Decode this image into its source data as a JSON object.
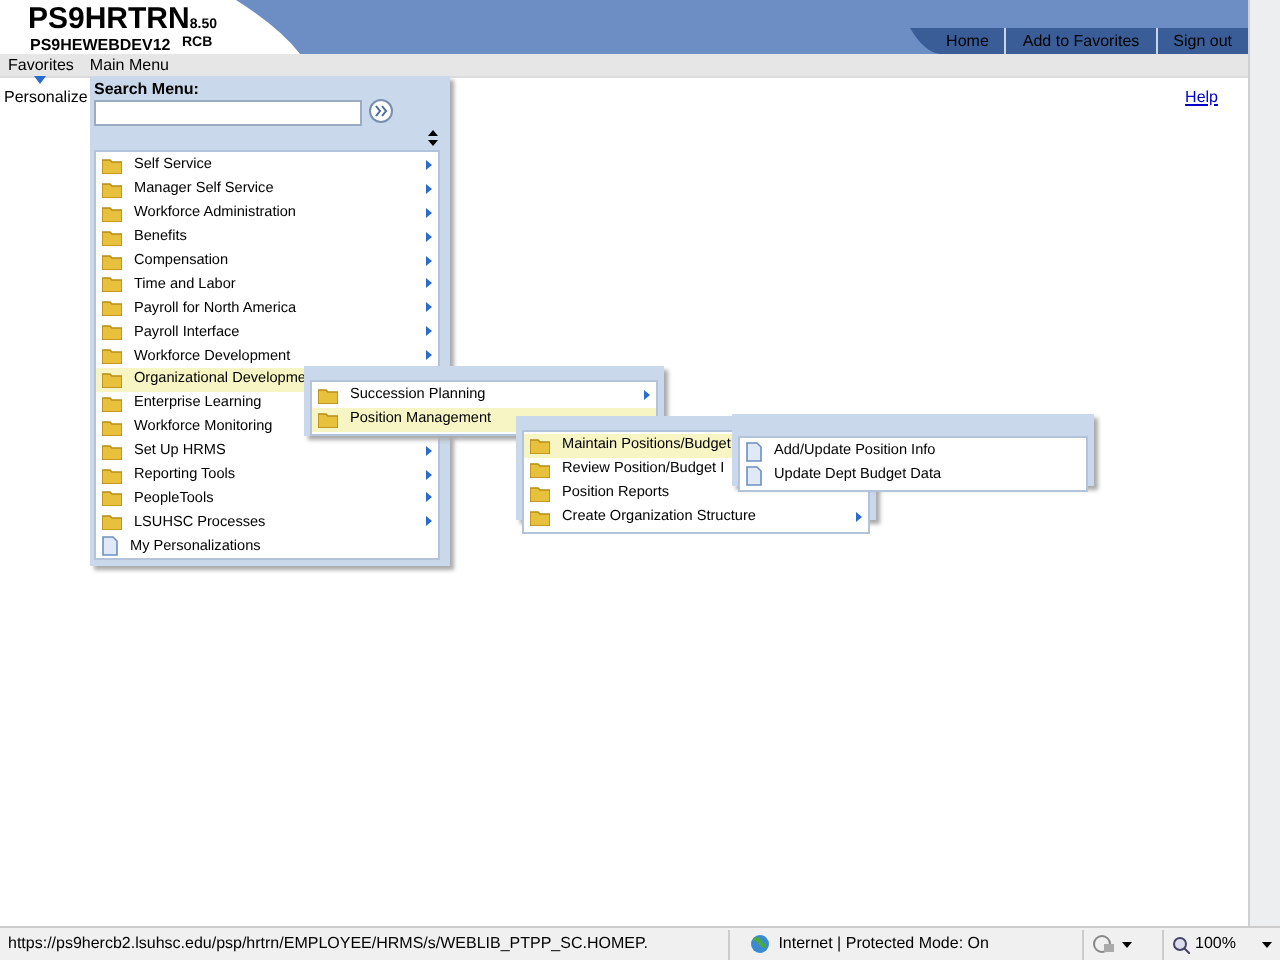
{
  "header": {
    "app_title": "PS9HRTRN",
    "version": "8.50",
    "server": "PS9HEWEBDEV12",
    "user": "RCB",
    "links": [
      "Home",
      "Add to Favorites",
      "Sign out"
    ]
  },
  "menubar": [
    "Favorites",
    "Main Menu"
  ],
  "page": {
    "personalize": "Personalize",
    "help": "Help"
  },
  "main_menu": {
    "search_label": "Search Menu:",
    "items": [
      {
        "label": "Self Service",
        "kind": "folder",
        "has_arrow": true,
        "selected": false
      },
      {
        "label": "Manager Self Service",
        "kind": "folder",
        "has_arrow": true,
        "selected": false
      },
      {
        "label": "Workforce Administration",
        "kind": "folder",
        "has_arrow": true,
        "selected": false
      },
      {
        "label": "Benefits",
        "kind": "folder",
        "has_arrow": true,
        "selected": false
      },
      {
        "label": "Compensation",
        "kind": "folder",
        "has_arrow": true,
        "selected": false
      },
      {
        "label": "Time and Labor",
        "kind": "folder",
        "has_arrow": true,
        "selected": false
      },
      {
        "label": "Payroll for North America",
        "kind": "folder",
        "has_arrow": true,
        "selected": false
      },
      {
        "label": "Payroll Interface",
        "kind": "folder",
        "has_arrow": true,
        "selected": false
      },
      {
        "label": "Workforce Development",
        "kind": "folder",
        "has_arrow": true,
        "selected": false
      },
      {
        "label": "Organizational Developme",
        "kind": "folder",
        "selected": true
      },
      {
        "label": "Enterprise Learning",
        "kind": "folder",
        "selected": false
      },
      {
        "label": "Workforce Monitoring",
        "kind": "folder",
        "selected": false
      },
      {
        "label": "Set Up HRMS",
        "kind": "folder",
        "has_arrow": true,
        "selected": false
      },
      {
        "label": "Reporting Tools",
        "kind": "folder",
        "has_arrow": true,
        "selected": false
      },
      {
        "label": "PeopleTools",
        "kind": "folder",
        "has_arrow": true,
        "selected": false
      },
      {
        "label": "LSUHSC Processes",
        "kind": "folder",
        "has_arrow": true,
        "selected": false
      },
      {
        "label": "My Personalizations",
        "kind": "page",
        "has_arrow": false,
        "selected": false
      }
    ]
  },
  "submenus": [
    {
      "items": [
        {
          "label": "Succession Planning",
          "kind": "folder",
          "has_arrow": true,
          "selected": false
        },
        {
          "label": "Position Management",
          "kind": "folder",
          "selected": true
        }
      ]
    },
    {
      "items": [
        {
          "label": "Maintain Positions/Budget",
          "kind": "folder",
          "selected": true
        },
        {
          "label": "Review Position/Budget I",
          "kind": "folder",
          "selected": false
        },
        {
          "label": "Position Reports",
          "kind": "folder",
          "selected": false
        },
        {
          "label": "Create Organization Structure",
          "kind": "folder",
          "has_arrow": true,
          "selected": false
        }
      ]
    },
    {
      "items": [
        {
          "label": "Add/Update Position Info",
          "kind": "page",
          "has_arrow": false,
          "selected": false
        },
        {
          "label": "Update Dept Budget Data",
          "kind": "page",
          "has_arrow": false,
          "selected": false
        }
      ]
    }
  ],
  "status_bar": {
    "url": "https://ps9hercb2.lsuhsc.edu/psp/hrtrn/EMPLOYEE/HRMS/s/WEBLIB_PTPP_SC.HOMEP.",
    "zone": "Internet | Protected Mode: On",
    "zoom": "100%"
  }
}
